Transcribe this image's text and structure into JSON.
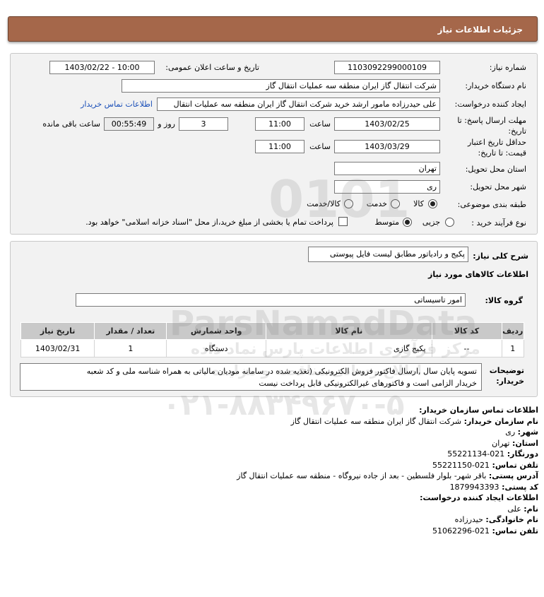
{
  "header": {
    "title": "جزئیات اطلاعات نیاز"
  },
  "form": {
    "need_number_label": "شماره نیاز:",
    "need_number": "1103092299000109",
    "announce_label": "تاریخ و ساعت اعلان عمومی:",
    "announce_value": "1403/02/22 - 10:00",
    "buyer_org_label": "نام دستگاه خریدار:",
    "buyer_org": "شرکت انتقال گاز ایران منطقه سه عملیات انتقال گاز",
    "creator_label": "ایجاد کننده درخواست:",
    "creator": "علی حیدرزاده مامور ارشد خرید شرکت انتقال گاز ایران منطقه سه عملیات انتقال",
    "buyer_contact_link": "اطلاعات تماس خریدار",
    "reply_deadline_label_1": "مهلت ارسال پاسخ: تا",
    "reply_deadline_label_2": "تاریخ:",
    "reply_date": "1403/02/25",
    "time_label": "ساعت",
    "reply_time": "11:00",
    "days_value": "3",
    "days_label": "روز و",
    "remaining_time": "00:55:49",
    "remaining_label": "ساعت باقی مانده",
    "price_validity_label_1": "حداقل تاریخ اعتبار",
    "price_validity_label_2": "قیمت: تا تاریخ:",
    "validity_date": "1403/03/29",
    "validity_time": "11:00",
    "province_label": "استان محل تحویل:",
    "province": "تهران",
    "city_label": "شهر محل تحویل:",
    "city": "ری",
    "category_label": "طبقه بندی موضوعی:",
    "category_options": [
      "کالا",
      "خدمت",
      "کالا/خدمت"
    ],
    "process_label": "نوع فرآیند خرید :",
    "process_options": [
      "جزیی",
      "متوسط"
    ],
    "payment_text": "پرداخت تمام یا بخشی از مبلغ خرید،از محل \"اسناد خزانه اسلامی\" خواهد بود."
  },
  "details": {
    "summary_label": "شرح کلی نیاز:",
    "summary": "پکیج و رادیاتور مطابق لیست فایل پیوستی",
    "goods_info_title": "اطلاعات کالاهای مورد نیاز",
    "goods_group_label": "گروه کالا:",
    "goods_group": "امور تاسیساتی",
    "table": {
      "headers": [
        "ردیف",
        "کد کالا",
        "نام کالا",
        "واحد شمارش",
        "تعداد / مقدار",
        "تاریخ نیاز"
      ],
      "rows": [
        [
          "1",
          "--",
          "پکیج گازی",
          "دستگاه",
          "1",
          "1403/02/31"
        ]
      ]
    },
    "buyer_notes_label_1": "توضیحات",
    "buyer_notes_label_2": "خریدار:",
    "buyer_notes_line1": "تسویه پایان سال ,ارسال فاکتور فروش الکترونیکی (تغذیه شده در سامانه مودیان مالیاتی به همراه شناسه ملی و کد شعبه",
    "buyer_notes_line2": "خریدار الزامی است و فاکتورهای غیرالکترونیکی قابل پرداخت نیست"
  },
  "contact": {
    "title": "اطلاعات تماس سازمان خریدار:",
    "buyer_name_label": "نام سازمان خریدار:",
    "buyer_name": "شرکت انتقال گاز ایران منطقه سه عملیات انتقال گاز",
    "city_label": "شهر:",
    "city": "ری",
    "province_label": "استان:",
    "province": "تهران",
    "fax_label": "دورنگار:",
    "fax": "021-55221134",
    "phone_label": "تلفن تماس:",
    "phone": "021-55221150",
    "address_label": "آدرس پستی:",
    "address": "باقر شهر- بلوار فلسطین - بعد از جاده نیروگاه - منطقه سه عملیات انتقال گاز",
    "postal_label": "کد پستی:",
    "postal": "1879943393",
    "creator_title": "اطلاعات ایجاد کننده درخواست:",
    "first_name_label": "نام:",
    "first_name": "علی",
    "last_name_label": "نام خانوادگی:",
    "last_name": "حیدرزاده",
    "creator_phone_label": "تلفن تماس:",
    "creator_phone": "021-51062296"
  },
  "watermark": {
    "number": "0101",
    "brand": "ParsNamadData",
    "subtitle": "مرکز فرآوری اطلاعات پارس نماد داده",
    "subtitle2": "اطلاع رسانی مناقصه و مزایده",
    "phone": "۰۲۱-۸۸۳۴۹۶۷۰-۵"
  }
}
